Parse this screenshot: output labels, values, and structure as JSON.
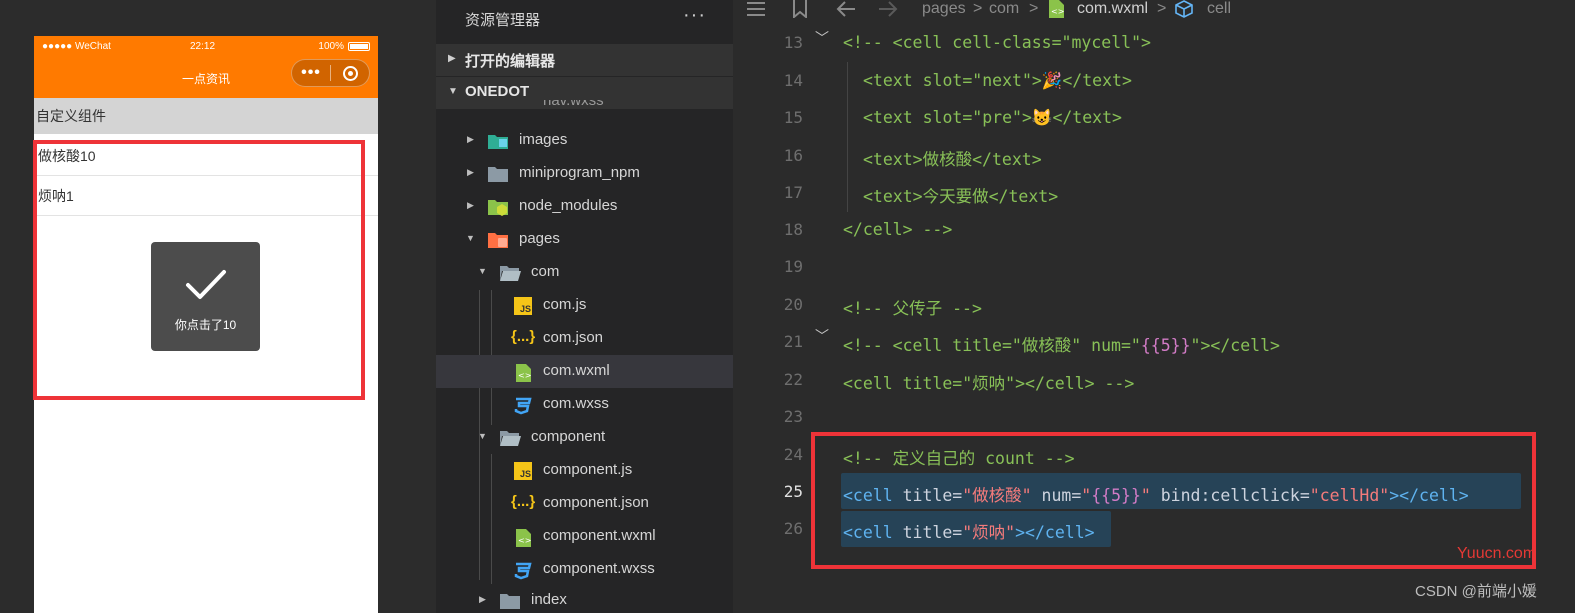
{
  "simulator": {
    "status_bar": {
      "carrier": "●●●●● WeChat",
      "time": "22:12",
      "battery": "100%"
    },
    "nav_title": "一点资讯",
    "capsule_dots": "•••",
    "section_header": "自定义组件",
    "cells": [
      {
        "text": "做核酸10"
      },
      {
        "text": "烦呐1"
      }
    ],
    "toast": {
      "text": "你点击了10"
    },
    "theme_color": "#ff7a00"
  },
  "explorer": {
    "title": "资源管理器",
    "more": "···",
    "sections": [
      {
        "label": "打开的编辑器"
      },
      {
        "label": "ONEDOT"
      }
    ],
    "partial_item": "nav.wxss",
    "items": [
      {
        "label": "images"
      },
      {
        "label": "miniprogram_npm"
      },
      {
        "label": "node_modules"
      },
      {
        "label": "pages"
      },
      {
        "label": "com"
      },
      {
        "label": "com.js"
      },
      {
        "label": "com.json"
      },
      {
        "label": "com.wxml"
      },
      {
        "label": "com.wxss"
      },
      {
        "label": "component"
      },
      {
        "label": "component.js"
      },
      {
        "label": "component.json"
      },
      {
        "label": "component.wxml"
      },
      {
        "label": "component.wxss"
      },
      {
        "label": "index"
      }
    ],
    "icon_text": {
      "js": "JS",
      "json": "{...}"
    }
  },
  "editor": {
    "breadcrumb": {
      "pages": "pages",
      "com": "com",
      "file": "com.wxml",
      "node": "cell",
      "sep": ">"
    },
    "line_numbers": [
      "13",
      "14",
      "15",
      "16",
      "17",
      "18",
      "19",
      "20",
      "21",
      "22",
      "23",
      "24",
      "25",
      "26"
    ],
    "active_line": "25",
    "code": {
      "l13": {
        "c1": "<!-- <cell cell-class=\"mycell\">"
      },
      "l14": {
        "c1": "<text slot=\"next\">",
        "emoji": "🎉",
        "c2": "</text>"
      },
      "l15": {
        "c1": "<text slot=\"pre\">",
        "emoji": "😺",
        "c2": "</text>"
      },
      "l16": {
        "c1": "<text>做核酸</text>"
      },
      "l17": {
        "c1": "<text>今天要做</text>"
      },
      "l18": {
        "c1": "</cell> -->"
      },
      "l20": {
        "c1": "<!-- 父传子 -->"
      },
      "l21": {
        "c1": "<!-- <cell title=\"做核酸\" num=\"",
        "b1": "{{5}}",
        "c2": "\"></cell>"
      },
      "l22": {
        "c1": "<cell title=\"烦呐\"></cell> -->"
      },
      "l24": {
        "c1": "<!-- 定义自己的 count -->"
      },
      "l25": {
        "t1": "<cell",
        "a1": " title=",
        "s1": "\"做核酸\"",
        "a2": " num=",
        "s2": "\"",
        "b1": "{{5}}",
        "s3": "\"",
        "a3": " bind:cellclick=",
        "s4": "\"cellHd\"",
        "t2": "></cell>"
      },
      "l26": {
        "t1": "<cell",
        "a1": " title=",
        "s1": "\"烦呐\"",
        "t2": "></cell>"
      }
    }
  },
  "watermark": {
    "site": "Yuucn.com",
    "author": "CSDN @前端小媛"
  }
}
